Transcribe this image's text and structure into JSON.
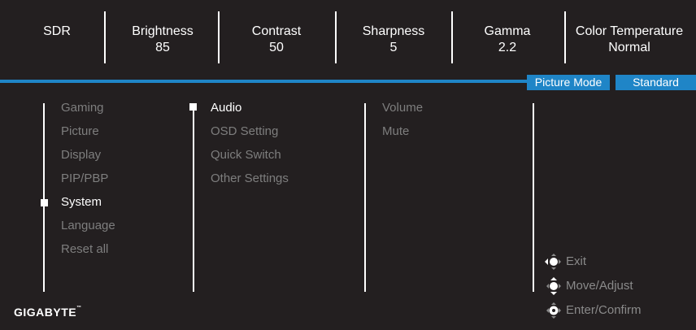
{
  "header": {
    "stats": [
      {
        "label": "SDR",
        "value": ""
      },
      {
        "label": "Brightness",
        "value": "85"
      },
      {
        "label": "Contrast",
        "value": "50"
      },
      {
        "label": "Sharpness",
        "value": "5"
      },
      {
        "label": "Gamma",
        "value": "2.2"
      },
      {
        "label": "Color Temperature",
        "value": "Normal"
      }
    ],
    "mode_label": "Picture Mode",
    "mode_value": "Standard"
  },
  "menu": {
    "main_items": [
      "Gaming",
      "Picture",
      "Display",
      "PIP/PBP",
      "System",
      "Language",
      "Reset all"
    ],
    "main_selected": "System",
    "sub_items": [
      "Audio",
      "OSD Setting",
      "Quick Switch",
      "Other Settings"
    ],
    "sub_selected": "Audio",
    "detail_items": [
      "Volume",
      "Mute"
    ]
  },
  "hints": [
    {
      "icon": "joystick-left-icon",
      "label": "Exit"
    },
    {
      "icon": "joystick-up-down-icon",
      "label": "Move/Adjust"
    },
    {
      "icon": "joystick-press-icon",
      "label": "Enter/Confirm"
    }
  ],
  "brand": {
    "name": "GIGABYTE",
    "mark": "™"
  },
  "colors": {
    "accent": "#1f85c7",
    "background": "#231f20",
    "inactive_text": "#7e7e7e",
    "active_text": "#ffffff"
  }
}
